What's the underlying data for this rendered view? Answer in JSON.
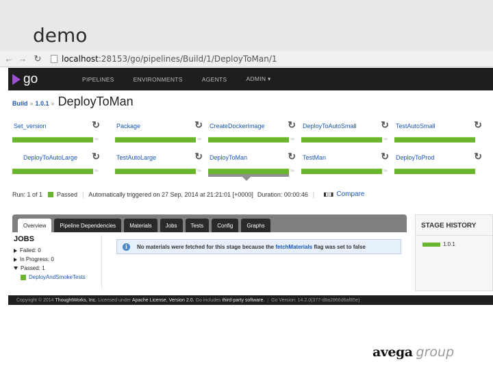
{
  "slide": {
    "title": "demo"
  },
  "browser": {
    "back_icon": "back-arrow-icon",
    "forward_icon": "forward-arrow-icon",
    "reload_icon": "reload-icon",
    "url_host": "localhost",
    "url_rest": ":28153/go/pipelines/Build/1/DeployToMan/1"
  },
  "header": {
    "logo_text": "go",
    "nav": [
      "PIPELINES",
      "ENVIRONMENTS",
      "AGENTS",
      "ADMIN ▾"
    ]
  },
  "breadcrumb": {
    "pipeline": "Build",
    "sep1": "»",
    "label": "1.0.1",
    "sep2": "»",
    "stage": "DeployToMan"
  },
  "stages": [
    {
      "name": "Set_version",
      "status": "passed"
    },
    {
      "name": "Package",
      "status": "passed"
    },
    {
      "name": "CreateDockerImage",
      "status": "passed"
    },
    {
      "name": "DeployToAutoSmall",
      "status": "passed"
    },
    {
      "name": "TestAutoSmall",
      "status": "passed"
    },
    {
      "name": "DeployToAutoLarge",
      "status": "passed"
    },
    {
      "name": "TestAutoLarge",
      "status": "passed"
    },
    {
      "name": "DeployToMan",
      "status": "passed",
      "current": true
    },
    {
      "name": "TestMan",
      "status": "passed"
    },
    {
      "name": "DeployToProd",
      "status": "passed"
    }
  ],
  "run_info": {
    "run": "Run: 1 of 1",
    "status": "Passed",
    "trigger": "Automatically triggered on 27 Sep, 2014 at 21:21:01 [+0000]",
    "duration": "Duration: 00:00:46",
    "compare": "Compare"
  },
  "tabs": [
    "Overview",
    "Pipeline Dependencies",
    "Materials",
    "Jobs",
    "Tests",
    "Config",
    "Graphs"
  ],
  "jobs": {
    "heading": "JOBS",
    "failed": "Failed: 0",
    "in_progress": "In Progress: 0",
    "passed": "Passed: 1",
    "job_name": "DeployAndSmokeTests"
  },
  "info": {
    "prefix": "No materials were fetched for this stage because the",
    "link": "fetchMaterials",
    "suffix": "flag was set to false"
  },
  "history": {
    "heading": "STAGE HISTORY",
    "entry": "1.0.1"
  },
  "footer": {
    "copyright": "Copyright © 2014",
    "company": "ThoughtWorks, Inc.",
    "licensed": "Licensed under",
    "license": "Apache License, Version 2.0.",
    "includes": "Go includes",
    "third_party": "third-party software.",
    "version": "Go Version: 14.2.0(377-d8a2866d6af85e)"
  },
  "brand": {
    "bold": "avega",
    "light": "group"
  },
  "colors": {
    "pass_green": "#6bb42d",
    "link_blue": "#1a56b8",
    "header_bg": "#1e1e1e"
  }
}
